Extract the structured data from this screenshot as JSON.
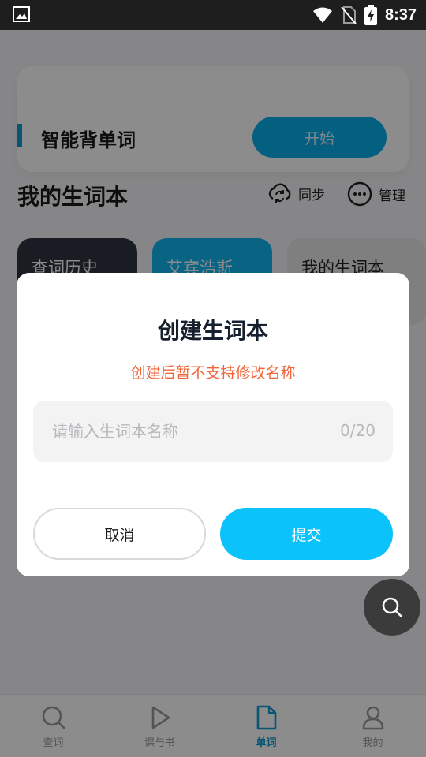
{
  "status_bar": {
    "time": "8:37",
    "icons": [
      "image-icon",
      "wifi-icon",
      "no-sim-icon",
      "battery-charging-icon"
    ]
  },
  "start_card": {
    "title": "智能背单词",
    "start_label": "开始"
  },
  "wordbook_section": {
    "title": "我的生词本",
    "sync_label": "同步",
    "manage_label": "管理",
    "books": [
      "查词历史",
      "艾宾浩斯",
      "我的生词本"
    ]
  },
  "dialog": {
    "title": "创建生词本",
    "subtitle": "创建后暂不支持修改名称",
    "input_placeholder": "请输入生词本名称",
    "input_value": "",
    "counter": "0/20",
    "cancel_label": "取消",
    "submit_label": "提交"
  },
  "bottom_nav": {
    "items": [
      {
        "label": "查词",
        "icon": "search-icon"
      },
      {
        "label": "课与书",
        "icon": "play-icon"
      },
      {
        "label": "单词",
        "icon": "document-icon"
      },
      {
        "label": "我的",
        "icon": "person-icon"
      }
    ],
    "active_index": 2
  },
  "colors": {
    "accent": "#0aaeea",
    "submit": "#0cc2fb",
    "warning": "#f0653a"
  }
}
